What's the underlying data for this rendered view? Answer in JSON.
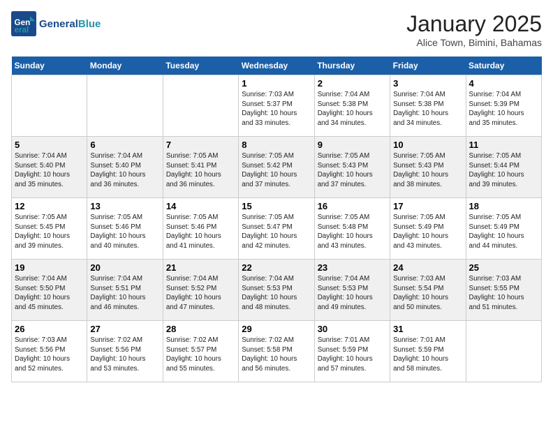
{
  "header": {
    "logo_line1": "General",
    "logo_line2": "Blue",
    "month": "January 2025",
    "location": "Alice Town, Bimini, Bahamas"
  },
  "days_of_week": [
    "Sunday",
    "Monday",
    "Tuesday",
    "Wednesday",
    "Thursday",
    "Friday",
    "Saturday"
  ],
  "weeks": [
    [
      {
        "day": "",
        "info": ""
      },
      {
        "day": "",
        "info": ""
      },
      {
        "day": "",
        "info": ""
      },
      {
        "day": "1",
        "info": "Sunrise: 7:03 AM\nSunset: 5:37 PM\nDaylight: 10 hours\nand 33 minutes."
      },
      {
        "day": "2",
        "info": "Sunrise: 7:04 AM\nSunset: 5:38 PM\nDaylight: 10 hours\nand 34 minutes."
      },
      {
        "day": "3",
        "info": "Sunrise: 7:04 AM\nSunset: 5:38 PM\nDaylight: 10 hours\nand 34 minutes."
      },
      {
        "day": "4",
        "info": "Sunrise: 7:04 AM\nSunset: 5:39 PM\nDaylight: 10 hours\nand 35 minutes."
      }
    ],
    [
      {
        "day": "5",
        "info": "Sunrise: 7:04 AM\nSunset: 5:40 PM\nDaylight: 10 hours\nand 35 minutes."
      },
      {
        "day": "6",
        "info": "Sunrise: 7:04 AM\nSunset: 5:40 PM\nDaylight: 10 hours\nand 36 minutes."
      },
      {
        "day": "7",
        "info": "Sunrise: 7:05 AM\nSunset: 5:41 PM\nDaylight: 10 hours\nand 36 minutes."
      },
      {
        "day": "8",
        "info": "Sunrise: 7:05 AM\nSunset: 5:42 PM\nDaylight: 10 hours\nand 37 minutes."
      },
      {
        "day": "9",
        "info": "Sunrise: 7:05 AM\nSunset: 5:43 PM\nDaylight: 10 hours\nand 37 minutes."
      },
      {
        "day": "10",
        "info": "Sunrise: 7:05 AM\nSunset: 5:43 PM\nDaylight: 10 hours\nand 38 minutes."
      },
      {
        "day": "11",
        "info": "Sunrise: 7:05 AM\nSunset: 5:44 PM\nDaylight: 10 hours\nand 39 minutes."
      }
    ],
    [
      {
        "day": "12",
        "info": "Sunrise: 7:05 AM\nSunset: 5:45 PM\nDaylight: 10 hours\nand 39 minutes."
      },
      {
        "day": "13",
        "info": "Sunrise: 7:05 AM\nSunset: 5:46 PM\nDaylight: 10 hours\nand 40 minutes."
      },
      {
        "day": "14",
        "info": "Sunrise: 7:05 AM\nSunset: 5:46 PM\nDaylight: 10 hours\nand 41 minutes."
      },
      {
        "day": "15",
        "info": "Sunrise: 7:05 AM\nSunset: 5:47 PM\nDaylight: 10 hours\nand 42 minutes."
      },
      {
        "day": "16",
        "info": "Sunrise: 7:05 AM\nSunset: 5:48 PM\nDaylight: 10 hours\nand 43 minutes."
      },
      {
        "day": "17",
        "info": "Sunrise: 7:05 AM\nSunset: 5:49 PM\nDaylight: 10 hours\nand 43 minutes."
      },
      {
        "day": "18",
        "info": "Sunrise: 7:05 AM\nSunset: 5:49 PM\nDaylight: 10 hours\nand 44 minutes."
      }
    ],
    [
      {
        "day": "19",
        "info": "Sunrise: 7:04 AM\nSunset: 5:50 PM\nDaylight: 10 hours\nand 45 minutes."
      },
      {
        "day": "20",
        "info": "Sunrise: 7:04 AM\nSunset: 5:51 PM\nDaylight: 10 hours\nand 46 minutes."
      },
      {
        "day": "21",
        "info": "Sunrise: 7:04 AM\nSunset: 5:52 PM\nDaylight: 10 hours\nand 47 minutes."
      },
      {
        "day": "22",
        "info": "Sunrise: 7:04 AM\nSunset: 5:53 PM\nDaylight: 10 hours\nand 48 minutes."
      },
      {
        "day": "23",
        "info": "Sunrise: 7:04 AM\nSunset: 5:53 PM\nDaylight: 10 hours\nand 49 minutes."
      },
      {
        "day": "24",
        "info": "Sunrise: 7:03 AM\nSunset: 5:54 PM\nDaylight: 10 hours\nand 50 minutes."
      },
      {
        "day": "25",
        "info": "Sunrise: 7:03 AM\nSunset: 5:55 PM\nDaylight: 10 hours\nand 51 minutes."
      }
    ],
    [
      {
        "day": "26",
        "info": "Sunrise: 7:03 AM\nSunset: 5:56 PM\nDaylight: 10 hours\nand 52 minutes."
      },
      {
        "day": "27",
        "info": "Sunrise: 7:02 AM\nSunset: 5:56 PM\nDaylight: 10 hours\nand 53 minutes."
      },
      {
        "day": "28",
        "info": "Sunrise: 7:02 AM\nSunset: 5:57 PM\nDaylight: 10 hours\nand 55 minutes."
      },
      {
        "day": "29",
        "info": "Sunrise: 7:02 AM\nSunset: 5:58 PM\nDaylight: 10 hours\nand 56 minutes."
      },
      {
        "day": "30",
        "info": "Sunrise: 7:01 AM\nSunset: 5:59 PM\nDaylight: 10 hours\nand 57 minutes."
      },
      {
        "day": "31",
        "info": "Sunrise: 7:01 AM\nSunset: 5:59 PM\nDaylight: 10 hours\nand 58 minutes."
      },
      {
        "day": "",
        "info": ""
      }
    ]
  ]
}
